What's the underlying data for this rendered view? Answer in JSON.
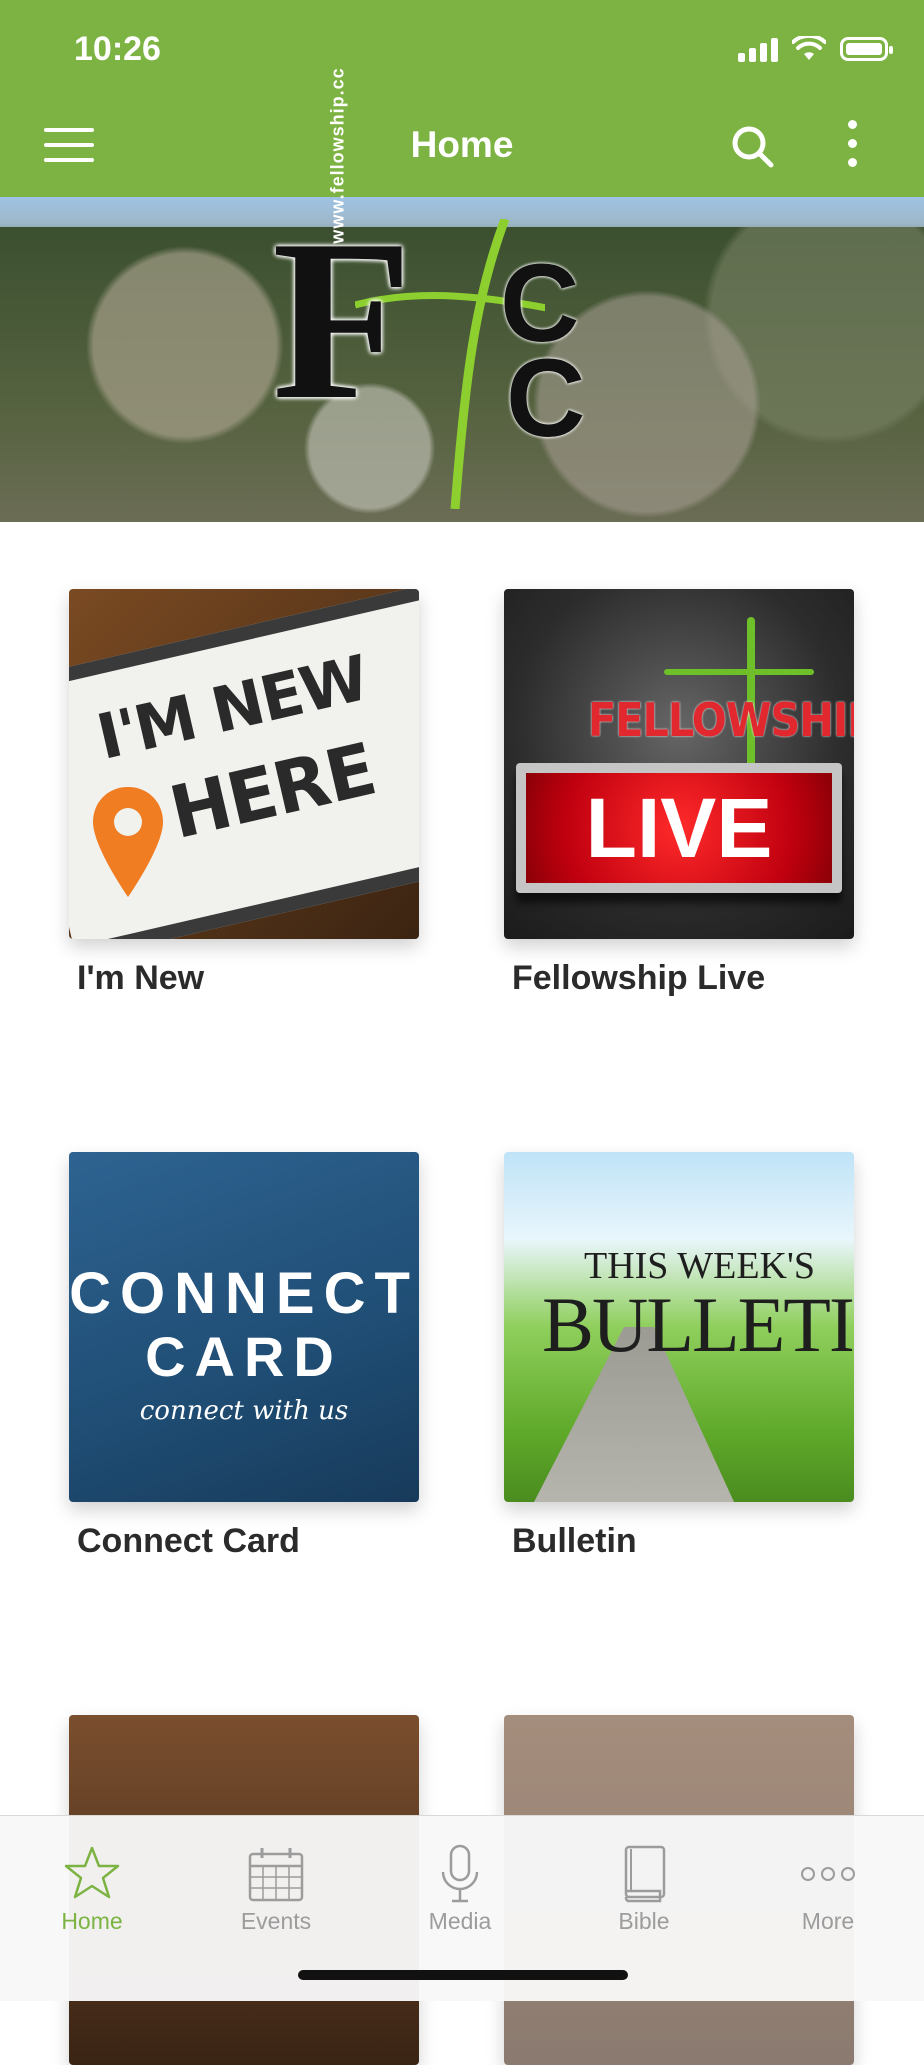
{
  "status_bar": {
    "time": "10:26"
  },
  "app_bar": {
    "title": "Home"
  },
  "banner": {
    "logo_letters": {
      "big": "F",
      "top": "C",
      "bottom": "C"
    },
    "url_text": "www.fellowship.cc"
  },
  "tiles": [
    {
      "label": "I'm New",
      "image_text": [
        "I'M NEW",
        "HERE"
      ]
    },
    {
      "label": "Fellowship Live",
      "image_text": [
        "FELLOWSHIP",
        "LIVE"
      ]
    },
    {
      "label": "Connect Card",
      "image_text": [
        "CONNECT",
        "CARD",
        "connect with us"
      ]
    },
    {
      "label": "Bulletin",
      "image_text": [
        "THIS WEEK'S",
        "BULLETIN"
      ]
    }
  ],
  "tab_bar": {
    "items": [
      {
        "label": "Home",
        "icon": "star-icon",
        "active": true
      },
      {
        "label": "Events",
        "icon": "calendar-icon",
        "active": false
      },
      {
        "label": "Media",
        "icon": "microphone-icon",
        "active": false
      },
      {
        "label": "Bible",
        "icon": "book-icon",
        "active": false
      },
      {
        "label": "More",
        "icon": "more-dots-icon",
        "active": false
      }
    ]
  },
  "colors": {
    "accent": "#7cb342",
    "tab_inactive": "#9c9c9c",
    "label_text": "#2b2b2b"
  }
}
